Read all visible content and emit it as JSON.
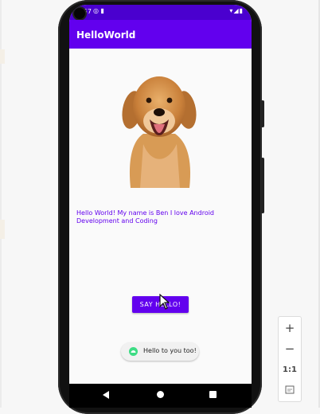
{
  "status_bar": {
    "time": "4:57",
    "icons_left": "◎ ▮",
    "icons_right": "▾◢▮"
  },
  "app_bar": {
    "title": "HelloWorld",
    "color": "#6200ee"
  },
  "content": {
    "image": "golden-retriever-dog-image",
    "message": "Hello World! My name is Ben I love Android Development and Coding",
    "button_label": "SAY HELLO!"
  },
  "toast": {
    "text": "Hello to you too!"
  },
  "nav_bar": {
    "back": "back-icon",
    "home": "home-icon",
    "recents": "recents-icon"
  },
  "zoom_controls": {
    "zoom_in": "+",
    "zoom_out": "−",
    "actual_size": "1:1",
    "fit_screen": "fit-screen-icon"
  }
}
